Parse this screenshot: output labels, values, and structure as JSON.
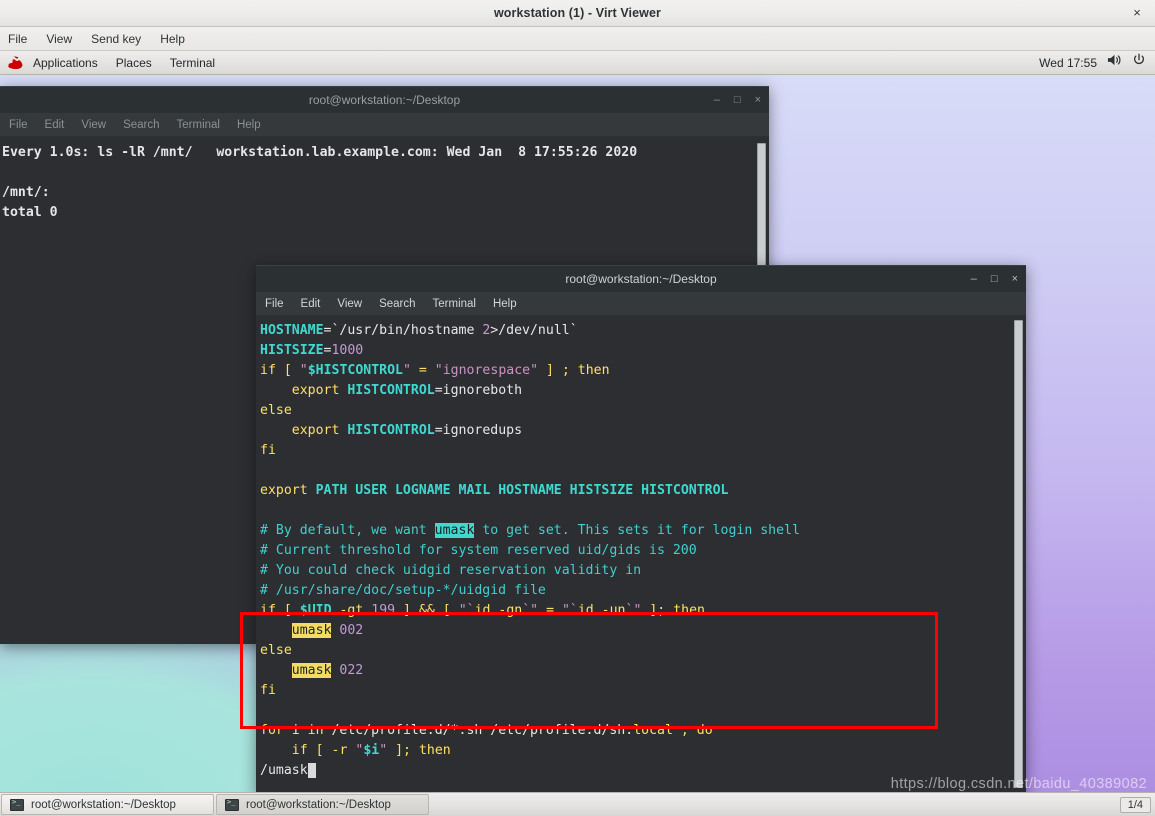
{
  "virt_viewer": {
    "title": "workstation (1) - Virt Viewer",
    "close_label": "×",
    "menu": [
      "File",
      "View",
      "Send key",
      "Help"
    ]
  },
  "gnome_panel": {
    "logo": "redhat-logo-icon",
    "items": [
      "Applications",
      "Places",
      "Terminal"
    ],
    "clock": "Wed 17:55",
    "volume_icon": "volume-icon",
    "power_icon": "power-icon"
  },
  "window1": {
    "title": "root@workstation:~/Desktop",
    "menu": [
      "File",
      "Edit",
      "View",
      "Search",
      "Terminal",
      "Help"
    ],
    "buttons": {
      "minimize": "–",
      "maximize": "□",
      "close": "×"
    },
    "lines": [
      "Every 1.0s: ls -lR /mnt/   workstation.lab.example.com: Wed Jan  8 17:55:26 2020",
      "",
      "/mnt/:",
      "total 0"
    ]
  },
  "window2": {
    "title": "root@workstation:~/Desktop",
    "menu": [
      "File",
      "Edit",
      "View",
      "Search",
      "Terminal",
      "Help"
    ],
    "buttons": {
      "minimize": "–",
      "maximize": "□",
      "close": "×"
    },
    "code_lines": [
      [
        {
          "t": "HOSTNAME",
          "c": "c-var"
        },
        {
          "t": "=`",
          "c": "c-txt"
        },
        {
          "t": "/usr/bin/hostname ",
          "c": "c-txt"
        },
        {
          "t": "2",
          "c": "c-num"
        },
        {
          "t": ">/dev/null`",
          "c": "c-txt"
        }
      ],
      [
        {
          "t": "HISTSIZE",
          "c": "c-var"
        },
        {
          "t": "=",
          "c": "c-txt"
        },
        {
          "t": "1000",
          "c": "c-num"
        }
      ],
      [
        {
          "t": "if",
          "c": "c-key"
        },
        {
          "t": " ",
          "c": "c-txt"
        },
        {
          "t": "[",
          "c": "c-key"
        },
        {
          "t": " ",
          "c": "c-txt"
        },
        {
          "t": "\"",
          "c": "c-str"
        },
        {
          "t": "$HISTCONTROL",
          "c": "c-var"
        },
        {
          "t": "\"",
          "c": "c-str"
        },
        {
          "t": " ",
          "c": "c-txt"
        },
        {
          "t": "=",
          "c": "c-key"
        },
        {
          "t": " ",
          "c": "c-txt"
        },
        {
          "t": "\"ignorespace\"",
          "c": "c-str"
        },
        {
          "t": " ",
          "c": "c-txt"
        },
        {
          "t": "]",
          "c": "c-key"
        },
        {
          "t": " ",
          "c": "c-txt"
        },
        {
          "t": ";",
          "c": "c-key"
        },
        {
          "t": " ",
          "c": "c-txt"
        },
        {
          "t": "then",
          "c": "c-key"
        }
      ],
      [
        {
          "t": "    ",
          "c": "c-txt"
        },
        {
          "t": "export",
          "c": "c-key"
        },
        {
          "t": " ",
          "c": "c-txt"
        },
        {
          "t": "HISTCONTROL",
          "c": "c-var"
        },
        {
          "t": "=ignoreboth",
          "c": "c-txt"
        }
      ],
      [
        {
          "t": "else",
          "c": "c-key"
        }
      ],
      [
        {
          "t": "    ",
          "c": "c-txt"
        },
        {
          "t": "export",
          "c": "c-key"
        },
        {
          "t": " ",
          "c": "c-txt"
        },
        {
          "t": "HISTCONTROL",
          "c": "c-var"
        },
        {
          "t": "=ignoredups",
          "c": "c-txt"
        }
      ],
      [
        {
          "t": "fi",
          "c": "c-key"
        }
      ],
      [
        {
          "t": "",
          "c": "c-txt"
        }
      ],
      [
        {
          "t": "export",
          "c": "c-key"
        },
        {
          "t": " ",
          "c": "c-txt"
        },
        {
          "t": "PATH USER LOGNAME MAIL HOSTNAME HISTSIZE HISTCONTROL",
          "c": "c-var"
        }
      ],
      [
        {
          "t": "",
          "c": "c-txt"
        }
      ],
      [
        {
          "t": "# By default, we want ",
          "c": "c-cmt"
        },
        {
          "t": "umask",
          "c": "hl-incs"
        },
        {
          "t": " to get set. This sets it for login shell",
          "c": "c-cmt"
        }
      ],
      [
        {
          "t": "# Current threshold for system reserved uid/gids is 200",
          "c": "c-cmt"
        }
      ],
      [
        {
          "t": "# You could check uidgid reservation validity in",
          "c": "c-cmt"
        }
      ],
      [
        {
          "t": "# /usr/share/doc/setup-*/uidgid file",
          "c": "c-cmt"
        }
      ],
      [
        {
          "t": "if",
          "c": "c-key"
        },
        {
          "t": " ",
          "c": "c-txt"
        },
        {
          "t": "[",
          "c": "c-key"
        },
        {
          "t": " ",
          "c": "c-txt"
        },
        {
          "t": "$UID",
          "c": "c-var"
        },
        {
          "t": " ",
          "c": "c-txt"
        },
        {
          "t": "-gt",
          "c": "c-key"
        },
        {
          "t": " ",
          "c": "c-txt"
        },
        {
          "t": "199",
          "c": "c-num"
        },
        {
          "t": " ",
          "c": "c-txt"
        },
        {
          "t": "]",
          "c": "c-key"
        },
        {
          "t": " ",
          "c": "c-txt"
        },
        {
          "t": "&&",
          "c": "c-key"
        },
        {
          "t": " ",
          "c": "c-txt"
        },
        {
          "t": "[",
          "c": "c-key"
        },
        {
          "t": " ",
          "c": "c-txt"
        },
        {
          "t": "\"`",
          "c": "c-str"
        },
        {
          "t": "id -gn",
          "c": "c-key"
        },
        {
          "t": "`\"",
          "c": "c-str"
        },
        {
          "t": " ",
          "c": "c-txt"
        },
        {
          "t": "=",
          "c": "c-key"
        },
        {
          "t": " ",
          "c": "c-txt"
        },
        {
          "t": "\"`",
          "c": "c-str"
        },
        {
          "t": "id -un",
          "c": "c-key"
        },
        {
          "t": "`\"",
          "c": "c-str"
        },
        {
          "t": " ",
          "c": "c-txt"
        },
        {
          "t": "];",
          "c": "c-key"
        },
        {
          "t": " ",
          "c": "c-txt"
        },
        {
          "t": "then",
          "c": "c-key"
        }
      ],
      [
        {
          "t": "    ",
          "c": "c-txt"
        },
        {
          "t": "umask",
          "c": "hl-search"
        },
        {
          "t": " ",
          "c": "c-txt"
        },
        {
          "t": "002",
          "c": "c-num"
        }
      ],
      [
        {
          "t": "else",
          "c": "c-key"
        }
      ],
      [
        {
          "t": "    ",
          "c": "c-txt"
        },
        {
          "t": "umask",
          "c": "hl-search"
        },
        {
          "t": " ",
          "c": "c-txt"
        },
        {
          "t": "022",
          "c": "c-num"
        }
      ],
      [
        {
          "t": "fi",
          "c": "c-key"
        }
      ],
      [
        {
          "t": "",
          "c": "c-txt"
        }
      ],
      [
        {
          "t": "for",
          "c": "c-key"
        },
        {
          "t": " i ",
          "c": "c-txt"
        },
        {
          "t": "in",
          "c": "c-key"
        },
        {
          "t": " /etc/profile.d/*.sh /etc/profile.d/sh.",
          "c": "c-txt"
        },
        {
          "t": "local",
          "c": "c-key"
        },
        {
          "t": " ",
          "c": "c-txt"
        },
        {
          "t": ";",
          "c": "c-key"
        },
        {
          "t": " ",
          "c": "c-txt"
        },
        {
          "t": "do",
          "c": "c-key"
        }
      ],
      [
        {
          "t": "    ",
          "c": "c-txt"
        },
        {
          "t": "if",
          "c": "c-key"
        },
        {
          "t": " ",
          "c": "c-txt"
        },
        {
          "t": "[",
          "c": "c-key"
        },
        {
          "t": " ",
          "c": "c-txt"
        },
        {
          "t": "-r",
          "c": "c-key"
        },
        {
          "t": " ",
          "c": "c-txt"
        },
        {
          "t": "\"",
          "c": "c-str"
        },
        {
          "t": "$i",
          "c": "c-var"
        },
        {
          "t": "\"",
          "c": "c-str"
        },
        {
          "t": " ",
          "c": "c-txt"
        },
        {
          "t": "];",
          "c": "c-key"
        },
        {
          "t": " ",
          "c": "c-txt"
        },
        {
          "t": "then",
          "c": "c-key"
        }
      ],
      [
        {
          "t": "/umask",
          "c": "c-txt"
        },
        {
          "t": " ",
          "c": "cursor-blk"
        }
      ]
    ],
    "search_prompt": "/umask",
    "highlight_box_color": "#ff0000"
  },
  "taskbar": {
    "buttons": [
      {
        "icon": "terminal-icon",
        "label": "root@workstation:~/Desktop"
      },
      {
        "icon": "terminal-icon",
        "label": "root@workstation:~/Desktop"
      }
    ],
    "workspace": "1/4"
  },
  "watermark": "https://blog.csdn.net/baidu_40389082"
}
